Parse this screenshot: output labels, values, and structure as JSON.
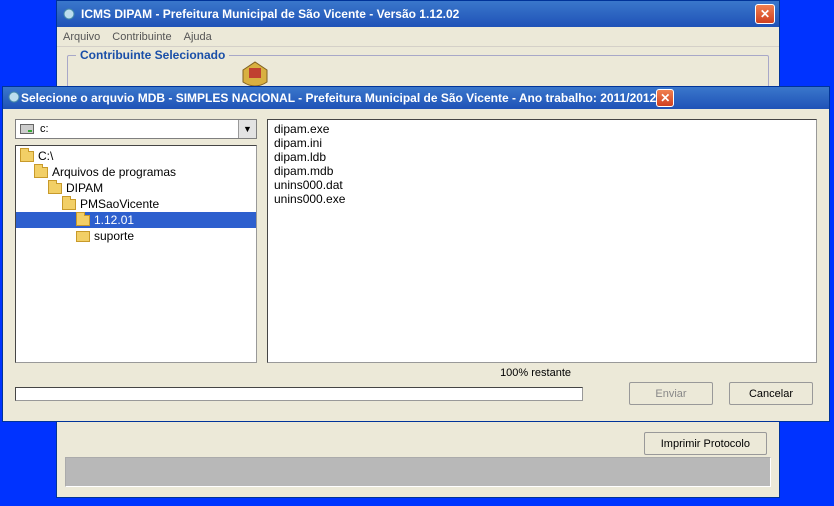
{
  "main_window": {
    "title": "ICMS DIPAM - Prefeitura Municipal de São Vicente - Versão 1.12.02",
    "menu": {
      "arquivo": "Arquivo",
      "contribuinte": "Contribuinte",
      "ajuda": "Ajuda"
    },
    "fieldset_title": "Contribuinte Selecionado",
    "print_button": "Imprimir Protocolo"
  },
  "dialog": {
    "title": "Selecione o arquvio MDB - SIMPLES NACIONAL - Prefeitura Municipal de São Vicente - Ano trabalho: 2011/2012",
    "drive": "c:",
    "dirs": [
      {
        "label": "C:\\",
        "indent": 0,
        "open": true,
        "selected": false
      },
      {
        "label": "Arquivos de programas",
        "indent": 1,
        "open": true,
        "selected": false
      },
      {
        "label": "DIPAM",
        "indent": 2,
        "open": true,
        "selected": false
      },
      {
        "label": "PMSaoVicente",
        "indent": 3,
        "open": true,
        "selected": false
      },
      {
        "label": "1.12.01",
        "indent": 4,
        "open": true,
        "selected": true
      },
      {
        "label": "suporte",
        "indent": 5,
        "open": false,
        "selected": false
      }
    ],
    "files": [
      "dipam.exe",
      "dipam.ini",
      "dipam.ldb",
      "dipam.mdb",
      "unins000.dat",
      "unins000.exe"
    ],
    "progress_label": "100% restante",
    "send_button": "Enviar",
    "cancel_button": "Cancelar"
  }
}
